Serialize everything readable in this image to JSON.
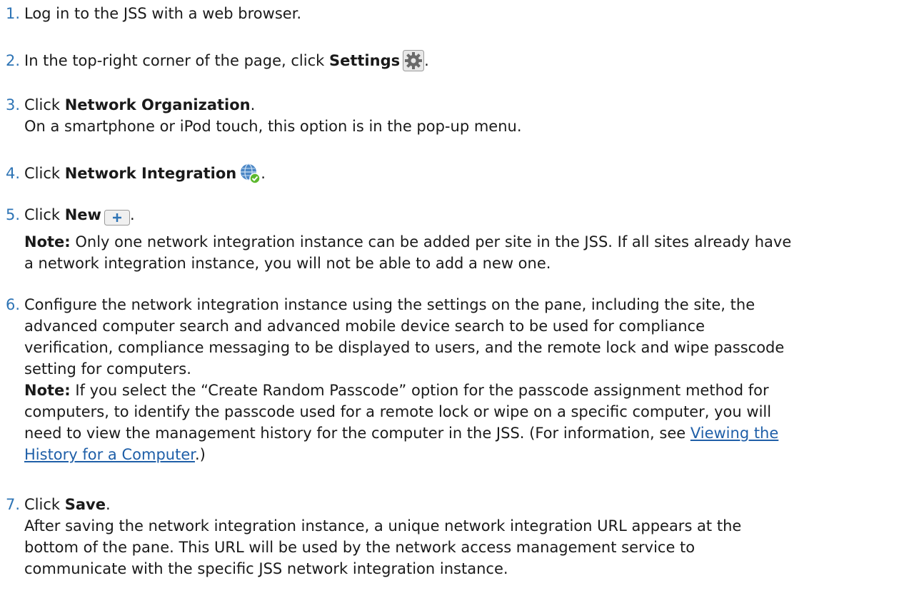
{
  "steps": [
    {
      "num": "1.",
      "t1": "Log in to the JSS with a web browser."
    },
    {
      "num": "2.",
      "t1": "In the top-right corner of the page, click ",
      "b1": "Settings",
      "t2": "."
    },
    {
      "num": "3.",
      "t1": "Click ",
      "b1": "Network Organization",
      "t2": ".",
      "line2": "On a smartphone or iPod touch, this option is in the pop-up menu."
    },
    {
      "num": "4.",
      "t1": "Click ",
      "b1": "Network Integration",
      "t2": "."
    },
    {
      "num": "5.",
      "t1": "Click ",
      "b1": "New",
      "t2": ".",
      "note_label": "Note:",
      "note_line1": " Only one network integration instance can be added per site in the JSS. If all sites already have",
      "note_line2": "a network integration instance, you will not be able to add a new one."
    },
    {
      "num": "6.",
      "l1": "Configure the network integration instance using the settings on the pane, including the site, the",
      "l2": "advanced computer search and advanced mobile device search to be used for compliance",
      "l3": "verification, compliance messaging to be displayed to users, and the remote lock and wipe passcode",
      "l4": "setting for computers.",
      "note_label": "Note:",
      "n1": " If you select the “Create Random Passcode” option for the passcode assignment method for",
      "n2": "computers, to identify the passcode used for a remote lock or wipe on a specific computer, you will",
      "n3": "need to view the management history for the computer in the JSS. (For information, see ",
      "link1": "Viewing the",
      "link2": "History for a Computer",
      "n4": ".)"
    },
    {
      "num": "7.",
      "t1": "Click ",
      "b1": "Save",
      "t2": ".",
      "l1": "After saving the network integration instance, a unique network integration URL appears at the",
      "l2": "bottom of the pane. This URL will be used by the network access management service to",
      "l3": "communicate with the specific JSS network integration instance."
    }
  ],
  "icons": {
    "settings": "gear-icon",
    "network": "globe-check-icon",
    "new": "plus-button-icon"
  }
}
